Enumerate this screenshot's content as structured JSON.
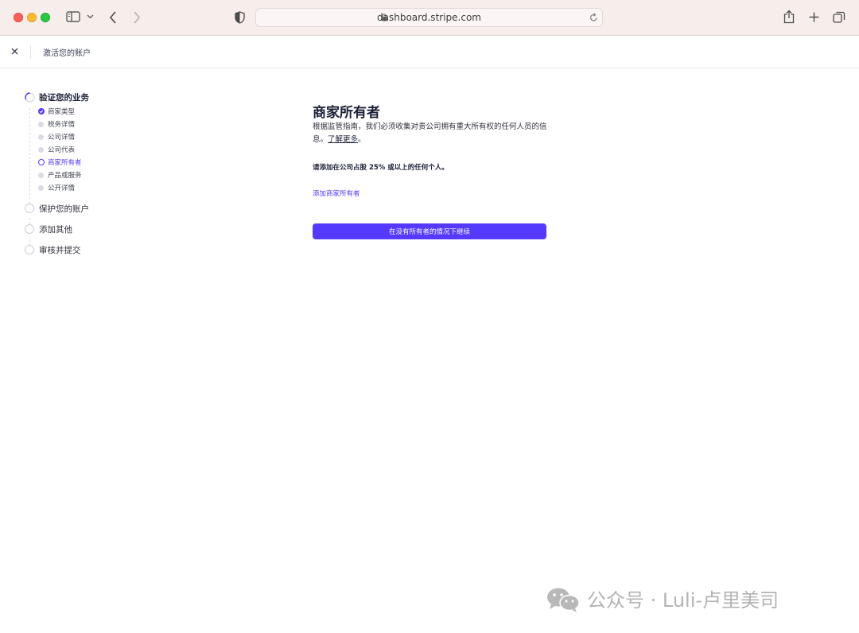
{
  "browser": {
    "url": "dashboard.stripe.com"
  },
  "topbar": {
    "title": "激活您的账户"
  },
  "sidebar": {
    "steps": [
      {
        "label": "验证您的业务",
        "state": "in-progress",
        "substeps": [
          {
            "label": "商家类型",
            "state": "done"
          },
          {
            "label": "税务详情",
            "state": "pending"
          },
          {
            "label": "公司详情",
            "state": "pending"
          },
          {
            "label": "公司代表",
            "state": "pending"
          },
          {
            "label": "商家所有者",
            "state": "current"
          },
          {
            "label": "产品或服务",
            "state": "pending"
          },
          {
            "label": "公开详情",
            "state": "pending"
          }
        ]
      },
      {
        "label": "保护您的账户",
        "state": "pending"
      },
      {
        "label": "添加其他",
        "state": "pending"
      },
      {
        "label": "审核并提交",
        "state": "pending"
      }
    ]
  },
  "main": {
    "heading": "商家所有者",
    "description": "根据监管指南，我们必须收集对贵公司拥有重大所有权的任何人员的信息。",
    "learn_more": "了解更多",
    "description_end": "。",
    "requirement": "请添加在公司占股 25% 或以上的任何个人。",
    "add_owner_link": "添加商家所有者",
    "continue_button": "在没有所有者的情况下继续"
  },
  "watermark": {
    "text": "公众号 · Luli-卢里美司"
  },
  "colors": {
    "accent": "#533afd",
    "chrome_bg": "#f7eeec"
  }
}
